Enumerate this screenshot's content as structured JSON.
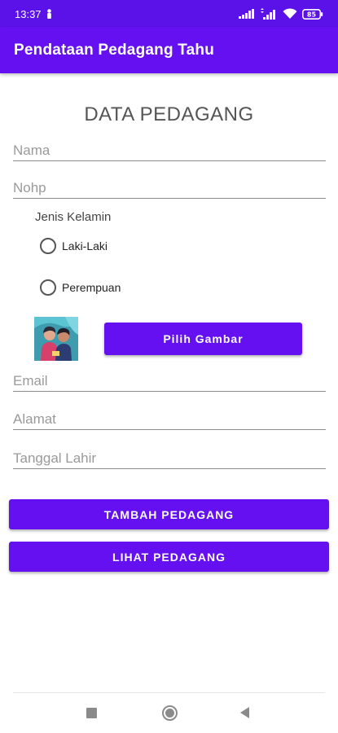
{
  "status_bar": {
    "time": "13:37",
    "battery": "85"
  },
  "app_bar": {
    "title": "Pendataan Pedagang Tahu"
  },
  "form": {
    "heading": "DATA PEDAGANG",
    "nama": {
      "placeholder": "Nama",
      "value": ""
    },
    "nohp": {
      "placeholder": "Nohp",
      "value": ""
    },
    "gender": {
      "label": "Jenis Kelamin",
      "options": [
        {
          "label": "Laki-Laki",
          "selected": false
        },
        {
          "label": "Perempuan",
          "selected": false
        }
      ]
    },
    "pick_image_label": "Pilih Gambar",
    "email": {
      "placeholder": "Email",
      "value": ""
    },
    "alamat": {
      "placeholder": "Alamat",
      "value": ""
    },
    "tanggal_lahir": {
      "placeholder": "Tanggal Lahir",
      "value": ""
    }
  },
  "actions": {
    "add_label": "TAMBAH PEDAGANG",
    "view_label": "LIHAT PEDAGANG"
  },
  "icons": {
    "status_left": "sim-person-icon",
    "signal": "cell-signal-icon",
    "wifi": "wifi-icon",
    "battery": "battery-icon",
    "avatar": "avatar-image",
    "nav_recents": "recents-square-icon",
    "nav_home": "home-circle-icon",
    "nav_back": "back-triangle-icon"
  },
  "colors": {
    "primary": "#6410f0",
    "status_bar": "#5a12e8",
    "text_hint": "#9a9a9a"
  }
}
